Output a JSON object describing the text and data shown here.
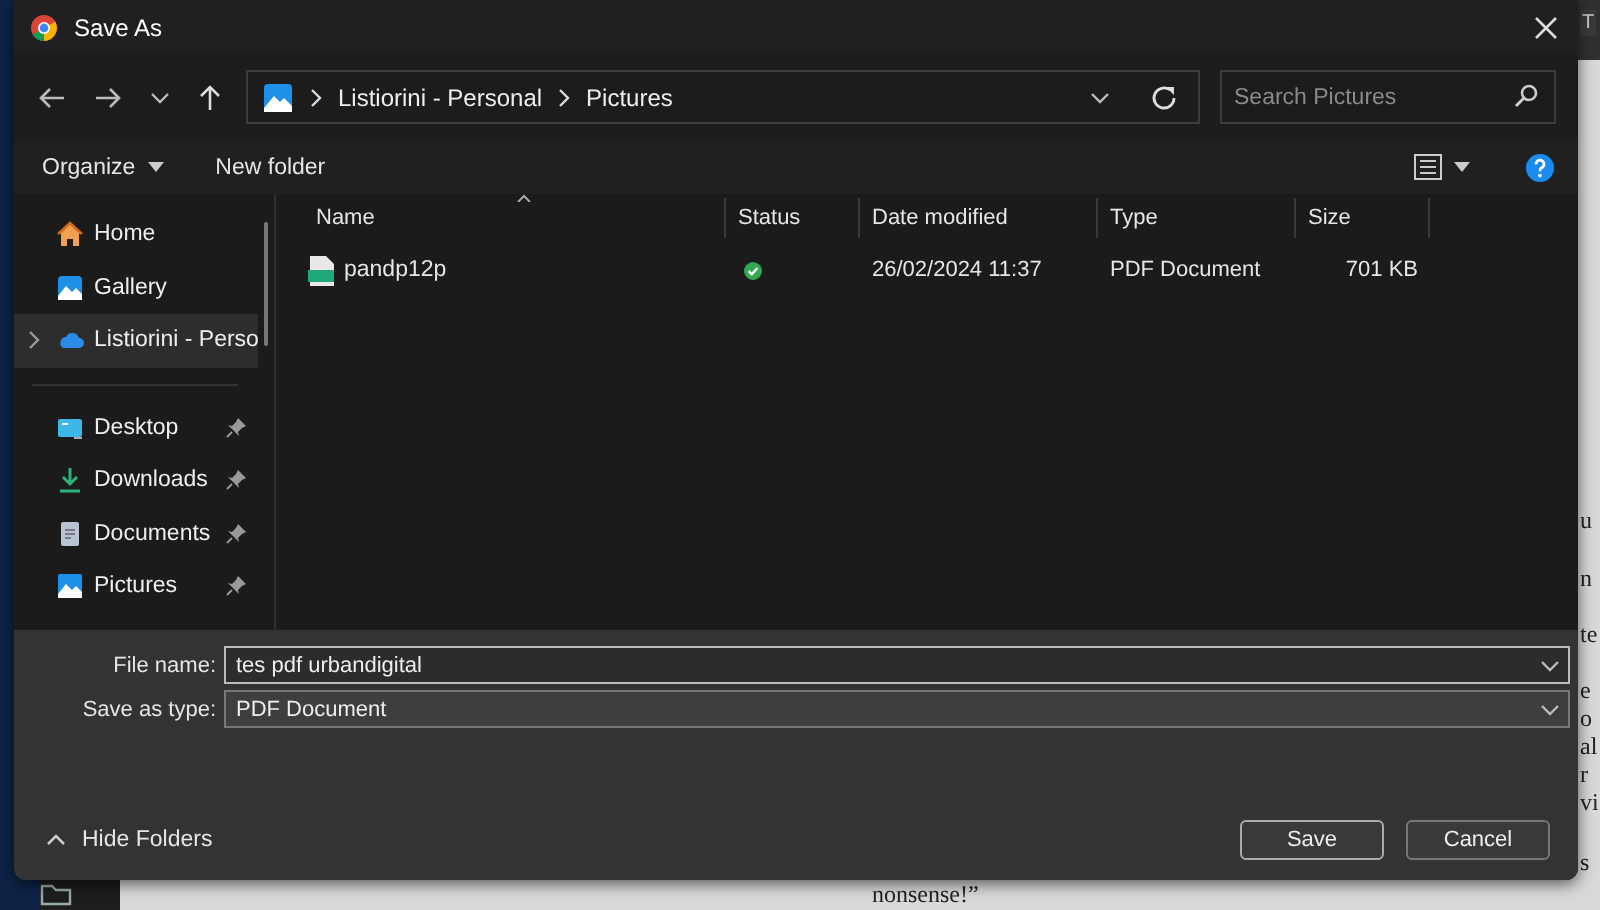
{
  "background": {
    "tab_label": "T",
    "page_fragments": [
      "u",
      "n",
      "te",
      "e",
      "o",
      "al",
      "r",
      "vi",
      "s"
    ],
    "page_line": "nonsense!”"
  },
  "window": {
    "title": "Save As"
  },
  "address_bar": {
    "path": [
      "Listiorini - Personal",
      "Pictures"
    ]
  },
  "search": {
    "placeholder": "Search Pictures"
  },
  "toolbar": [
    {
      "label": "Organize",
      "dropdown": true
    },
    {
      "label": "New folder",
      "dropdown": false
    }
  ],
  "sidebar": {
    "items": [
      {
        "kind": "home",
        "label": "Home",
        "selected": false,
        "pinned": false,
        "expandable": false
      },
      {
        "kind": "gallery",
        "label": "Gallery",
        "selected": false,
        "pinned": false,
        "expandable": false
      },
      {
        "kind": "cloud",
        "label": "Listiorini - Perso",
        "selected": true,
        "pinned": false,
        "expandable": true
      },
      {
        "kind": "desktop",
        "label": "Desktop",
        "selected": false,
        "pinned": true,
        "expandable": false
      },
      {
        "kind": "downloads",
        "label": "Downloads",
        "selected": false,
        "pinned": true,
        "expandable": false
      },
      {
        "kind": "documents",
        "label": "Documents",
        "selected": false,
        "pinned": true,
        "expandable": false
      },
      {
        "kind": "pictures",
        "label": "Pictures",
        "selected": false,
        "pinned": true,
        "expandable": false
      }
    ]
  },
  "table": {
    "columns": [
      "Name",
      "Status",
      "Date modified",
      "Type",
      "Size"
    ],
    "rows": [
      {
        "name": "pandp12p",
        "synced": true,
        "date": "26/02/2024 11:37",
        "type": "PDF Document",
        "size": "701 KB"
      }
    ]
  },
  "file_name": {
    "label": "File name:",
    "value": "tes pdf urbandigital"
  },
  "save_type": {
    "label": "Save as type:",
    "value": "PDF Document"
  },
  "hide_folders": "Hide Folders",
  "buttons": [
    "Save",
    "Cancel"
  ]
}
